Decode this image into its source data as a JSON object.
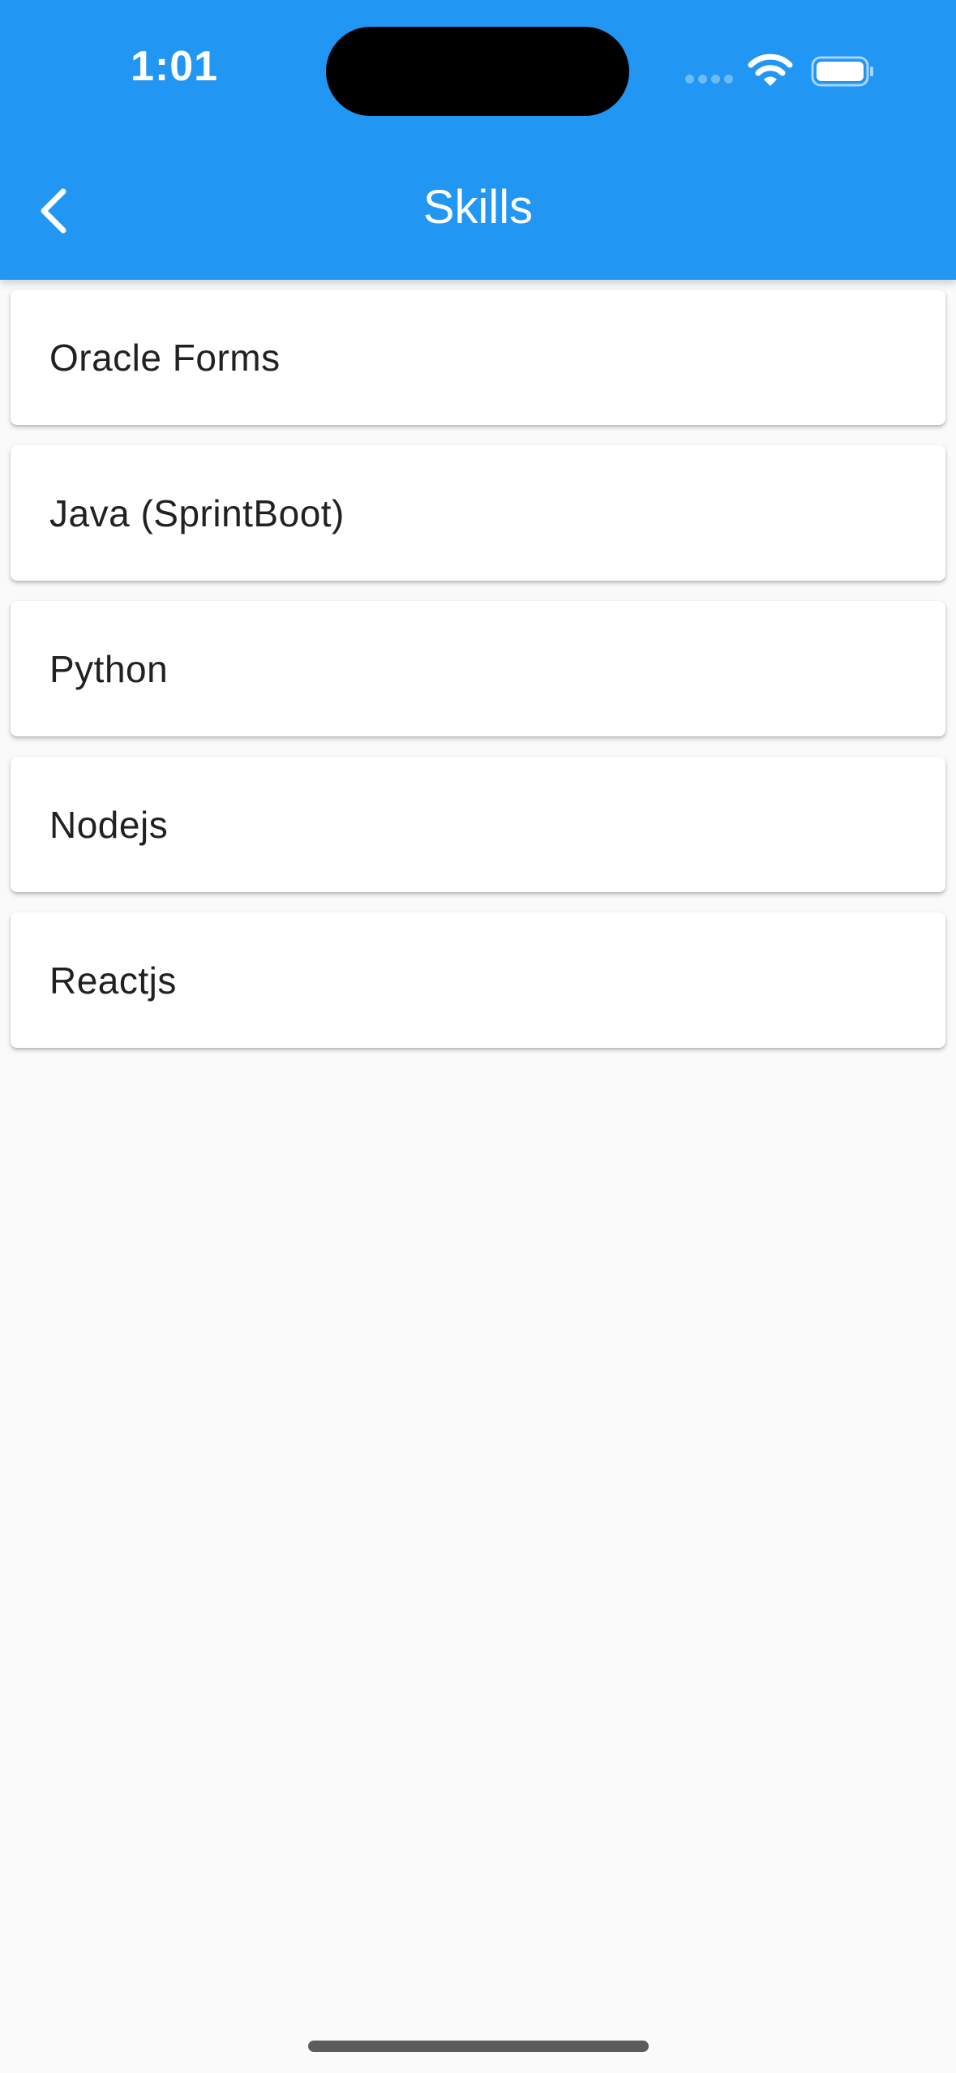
{
  "status_bar": {
    "time": "1:01"
  },
  "appbar": {
    "title": "Skills",
    "back_icon": "chevron-left-icon",
    "color": "#2196f3"
  },
  "skills": [
    {
      "label": "Oracle Forms"
    },
    {
      "label": "Java (SprintBoot)"
    },
    {
      "label": "Python"
    },
    {
      "label": "Nodejs"
    },
    {
      "label": "Reactjs"
    }
  ],
  "colors": {
    "background": "#fafafa",
    "card": "#ffffff",
    "text": "#212121"
  }
}
